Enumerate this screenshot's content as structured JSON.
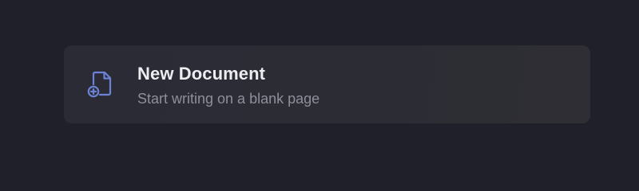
{
  "new_document_card": {
    "title": "New Document",
    "subtitle": "Start writing on a blank page",
    "icon": "file-plus-icon"
  },
  "colors": {
    "background": "#20202b",
    "card_background": "#2c2c35",
    "title_text": "#ececf1",
    "subtitle_text": "#8f8f9a",
    "icon_accent": "#6c83d4"
  }
}
